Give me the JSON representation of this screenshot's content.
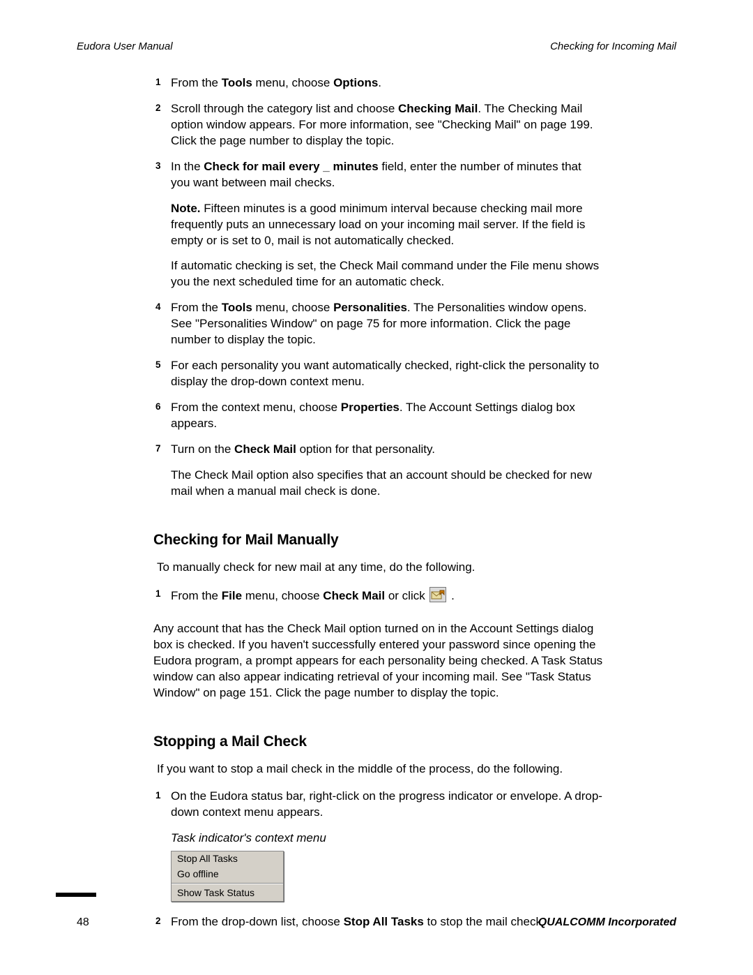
{
  "header": {
    "left": "Eudora User Manual",
    "right": "Checking for Incoming Mail"
  },
  "steps_a": [
    {
      "num": "1",
      "segs": [
        {
          "t": "From the "
        },
        {
          "t": "Tools",
          "b": true
        },
        {
          "t": " menu, choose "
        },
        {
          "t": "Options",
          "b": true
        },
        {
          "t": "."
        }
      ]
    },
    {
      "num": "2",
      "segs": [
        {
          "t": "Scroll through the category list and choose "
        },
        {
          "t": "Checking Mail",
          "b": true
        },
        {
          "t": ". The Checking Mail option window appears. For more information, see \"Checking Mail\" on page 199. Click the page number to display the topic."
        }
      ]
    },
    {
      "num": "3",
      "segs": [
        {
          "t": "In the "
        },
        {
          "t": "Check for mail every _ minutes",
          "b": true
        },
        {
          "t": " field, enter the number of minutes that you want between mail checks."
        }
      ],
      "after": [
        {
          "kind": "note",
          "segs": [
            {
              "t": "Note.",
              "b": true
            },
            {
              "t": " Fifteen minutes is a good minimum interval because checking mail more frequently puts an unnecessary load on your incoming mail server. If the field is empty or is set to 0, mail is not automatically checked."
            }
          ]
        },
        {
          "kind": "para",
          "segs": [
            {
              "t": "If automatic checking is set, the Check Mail command under the File menu shows you the next scheduled time for an automatic check."
            }
          ]
        }
      ]
    },
    {
      "num": "4",
      "segs": [
        {
          "t": "From the "
        },
        {
          "t": "Tools",
          "b": true
        },
        {
          "t": " menu, choose "
        },
        {
          "t": "Personalities",
          "b": true
        },
        {
          "t": ". The Personalities window opens. See \"Personalities Window\" on page 75 for more information. Click the page number to display the topic."
        }
      ]
    },
    {
      "num": "5",
      "segs": [
        {
          "t": "For each personality you want automatically checked, right-click the personality to display the drop-down context menu."
        }
      ]
    },
    {
      "num": "6",
      "segs": [
        {
          "t": "From the context menu, choose "
        },
        {
          "t": "Properties",
          "b": true
        },
        {
          "t": ". The Account Settings dialog box appears."
        }
      ]
    },
    {
      "num": "7",
      "segs": [
        {
          "t": " Turn on the "
        },
        {
          "t": "Check Mail",
          "b": true
        },
        {
          "t": " option for that personality."
        }
      ],
      "after": [
        {
          "kind": "para",
          "segs": [
            {
              "t": "The Check Mail option also specifies that an account should be checked for new mail when a manual mail check is done."
            }
          ]
        }
      ]
    }
  ],
  "section_manual": {
    "heading": "Checking for Mail Manually",
    "intro": "To manually check for new mail at any time, do the following.",
    "step": {
      "num": "1",
      "segs_before_icon": [
        {
          "t": " From the "
        },
        {
          "t": "File",
          "b": true
        },
        {
          "t": " menu, choose "
        },
        {
          "t": "Check Mail",
          "b": true
        },
        {
          "t": " or click "
        }
      ],
      "segs_after_icon": [
        {
          "t": " ."
        }
      ]
    },
    "para": "Any account that has the Check Mail option turned on in the Account Settings dialog box is checked. If you haven't successfully entered your password since opening the Eudora program, a prompt appears for each personality being checked. A Task Status window can also appear indicating retrieval of your incoming mail. See \"Task Status Window\" on page 151. Click the page number to display the topic."
  },
  "section_stop": {
    "heading": "Stopping a Mail Check",
    "intro": "If you want to stop a mail check in the middle of the process, do the following.",
    "step1": {
      "num": "1",
      "text": "On the Eudora status bar, right-click on the progress indicator or envelope. A drop-down context menu appears."
    },
    "caption": "Task indicator's context menu",
    "menu": {
      "item1": "Stop All Tasks",
      "item2": "Go offline",
      "item3": "Show Task Status"
    },
    "step2": {
      "num": "2",
      "segs": [
        {
          "t": "From the drop-down list, choose "
        },
        {
          "t": "Stop All Tasks",
          "b": true
        },
        {
          "t": " to stop the mail check."
        }
      ]
    }
  },
  "footer": {
    "company": "QUALCOMM Incorporated",
    "page": "48"
  }
}
